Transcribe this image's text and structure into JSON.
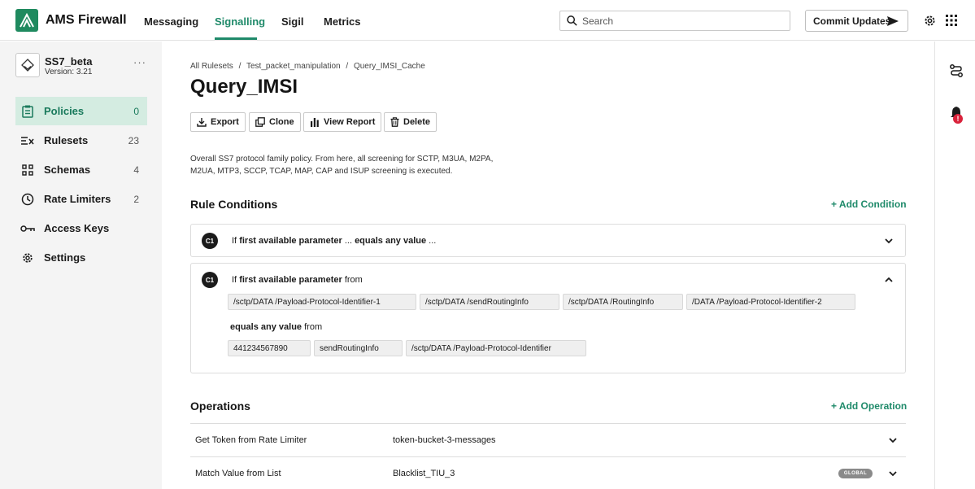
{
  "app": {
    "title": "AMS Firewall"
  },
  "nav": {
    "tabs": [
      "Messaging",
      "Signalling",
      "Sigil",
      "Metrics"
    ],
    "active": "Signalling"
  },
  "search": {
    "placeholder": "Search",
    "value": ""
  },
  "header": {
    "commit_label": "Commit Updates"
  },
  "project": {
    "name": "SS7_beta",
    "version": "Version: 3.21",
    "more": "···"
  },
  "sidebar": {
    "items": [
      {
        "label": "Policies",
        "count": "0",
        "icon": "clipboard-icon",
        "active": true
      },
      {
        "label": "Rulesets",
        "count": "23",
        "icon": "ruleset-icon"
      },
      {
        "label": "Schemas",
        "count": "4",
        "icon": "schema-grid-icon"
      },
      {
        "label": "Rate Limiters",
        "count": "2",
        "icon": "clock-icon"
      },
      {
        "label": "Access Keys",
        "count": "",
        "icon": "key-icon"
      },
      {
        "label": "Settings",
        "count": "",
        "icon": "gear-icon"
      }
    ]
  },
  "breadcrumb": [
    "All Rulesets",
    "/",
    "Test_packet_manipulation",
    "/",
    "Query_IMSI_Cache"
  ],
  "page": {
    "title": "Query_IMSI",
    "actions": {
      "export": "Export",
      "clone": "Clone",
      "view_report": "View Report",
      "delete": "Delete"
    },
    "description": "Overall SS7 protocol family policy.  From here, all screening for SCTP, M3UA, M2PA, M2UA, MTP3, SCCP, TCAP, MAP, CAP and ISUP screening is executed."
  },
  "conditions": {
    "title": "Rule Conditions",
    "add_label": "+ Add Condition",
    "collapsed": {
      "badge": "C1",
      "if": "If",
      "param": "first available parameter",
      "ellipsis1": "...",
      "op": "equals any value",
      "ellipsis2": "..."
    },
    "expanded": {
      "badge": "C1",
      "if": "If",
      "param": "first available parameter",
      "from": "from",
      "param_chips": [
        "/sctp/DATA /Payload-Protocol-Identifier-1",
        "/sctp/DATA /sendRoutingInfo",
        "/sctp/DATA /RoutingInfo",
        "/DATA /Payload-Protocol-Identifier-2"
      ],
      "op": "equals any value",
      "op_from": "from",
      "value_chips": [
        "441234567890",
        "sendRoutingInfo",
        "/sctp/DATA /Payload-Protocol-Identifier"
      ]
    }
  },
  "operations": {
    "title": "Operations",
    "add_label": "+ Add Operation",
    "rows": [
      {
        "name": "Get Token from Rate Limiter",
        "value": "token-bucket-3-messages",
        "tag": ""
      },
      {
        "name": "Match Value from List",
        "value": "Blacklist_TIU_3",
        "tag": "GLOBAL"
      }
    ]
  },
  "notifications": {
    "badge": "!"
  },
  "colors": {
    "accent": "#1f8a6a",
    "logo": "#1f8a5f",
    "active_bg": "#d4ece1",
    "alert": "#d9223b"
  }
}
